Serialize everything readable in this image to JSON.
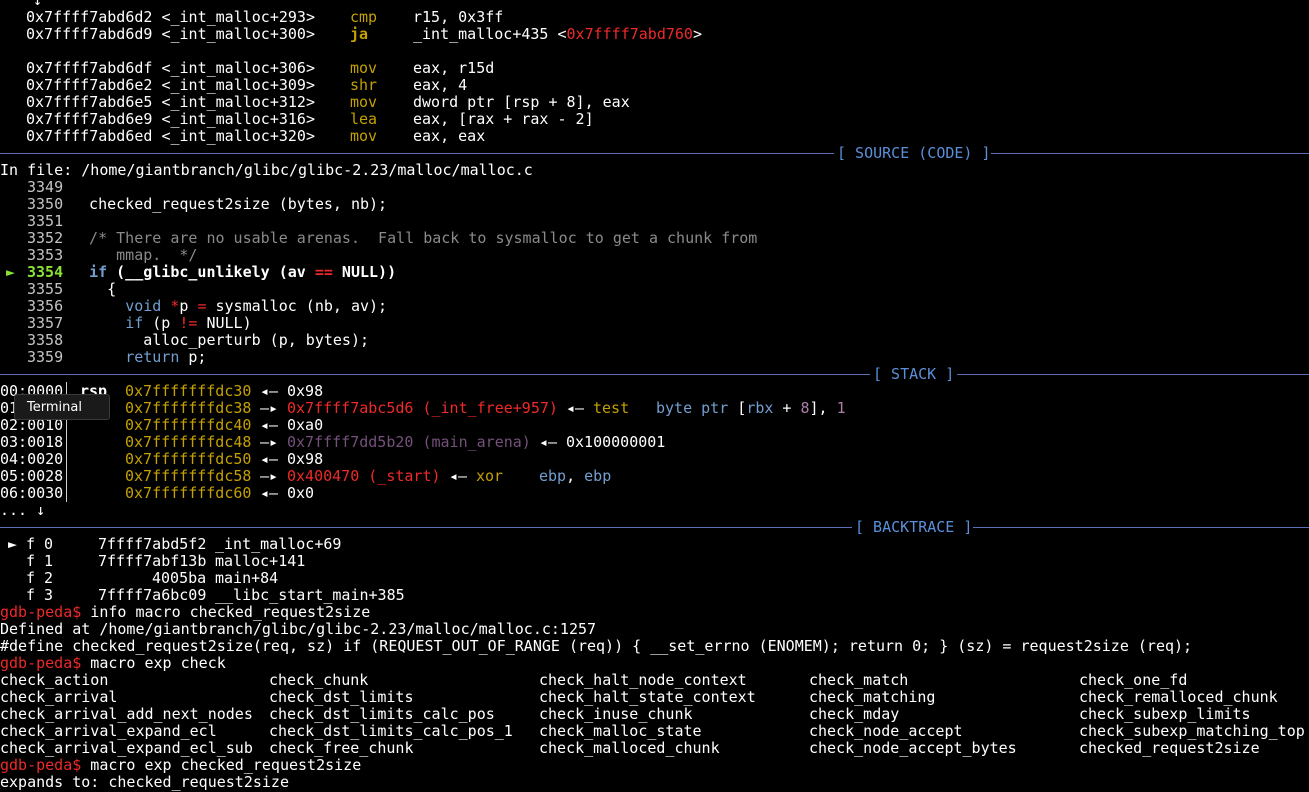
{
  "disasm": [
    {
      "addr": "0x7ffff7abd6d2",
      "sym": "<_int_malloc+293>",
      "op": "cmp",
      "args": "r15, 0x3ff"
    },
    {
      "addr": "0x7ffff7abd6d9",
      "sym": "<_int_malloc+300>",
      "op": "ja",
      "args": "_int_malloc+435 <",
      "target": "0x7ffff7abd760",
      "close": ">"
    },
    {
      "addr": "0x7ffff7abd6df",
      "sym": "<_int_malloc+306>",
      "op": "mov",
      "args": "eax, r15d"
    },
    {
      "addr": "0x7ffff7abd6e2",
      "sym": "<_int_malloc+309>",
      "op": "shr",
      "args": "eax, 4"
    },
    {
      "addr": "0x7ffff7abd6e5",
      "sym": "<_int_malloc+312>",
      "op": "mov",
      "args": "dword ptr [rsp + 8], eax"
    },
    {
      "addr": "0x7ffff7abd6e9",
      "sym": "<_int_malloc+316>",
      "op": "lea",
      "args": "eax, [rax + rax - 2]"
    },
    {
      "addr": "0x7ffff7abd6ed",
      "sym": "<_int_malloc+320>",
      "op": "mov",
      "args": "eax, eax"
    }
  ],
  "sections": {
    "source": "[ SOURCE (CODE) ]",
    "stack": "[ STACK ]",
    "backtrace": "[ BACKTRACE ]"
  },
  "source": {
    "file_line": "In file: /home/giantbranch/glibc/glibc-2.23/malloc/malloc.c",
    "lines": [
      {
        "no": "3349",
        "code": ""
      },
      {
        "no": "3350",
        "code": "  checked_request2size (bytes, nb);"
      },
      {
        "no": "3351",
        "code": ""
      },
      {
        "no": "3352",
        "code": "  /* There are no usable arenas.  Fall back to sysmalloc to get a chunk from"
      },
      {
        "no": "3353",
        "code": "     mmap.  */"
      },
      {
        "no": "3354",
        "code": "  if (__glibc_unlikely (av == NULL))",
        "current": true
      },
      {
        "no": "3355",
        "code": "    {"
      },
      {
        "no": "3356",
        "code": "      void *p = sysmalloc (nb, av);"
      },
      {
        "no": "3357",
        "code": "      if (p != NULL)"
      },
      {
        "no": "3358",
        "code": "        alloc_perturb (p, bytes);"
      },
      {
        "no": "3359",
        "code": "      return p;"
      }
    ],
    "current_marker": "►"
  },
  "stack": [
    {
      "idx": "00:0000",
      "reg": "rsp",
      "addr": "0x7fffffffdc30",
      "arrow": "◂—",
      "val": "0x98"
    },
    {
      "idx": "01:0008",
      "reg": "",
      "addr": "0x7fffffffdc38",
      "arrow": "—▸",
      "val": "0x7ffff7abc5d6 (_int_free+957)",
      "arrow2": "◂—",
      "ins": "test",
      "ins_args": "byte ptr [rbx + 8], 1"
    },
    {
      "idx": "02:0010",
      "reg": "",
      "addr": "0x7fffffffdc40",
      "arrow": "◂—",
      "val": "0xa0"
    },
    {
      "idx": "03:0018",
      "reg": "",
      "addr": "0x7fffffffdc48",
      "arrow": "—▸",
      "val": "0x7ffff7dd5b20 (main_arena)",
      "arrow2": "◂—",
      "tail": "0x100000001"
    },
    {
      "idx": "04:0020",
      "reg": "",
      "addr": "0x7fffffffdc50",
      "arrow": "◂—",
      "val": "0x98"
    },
    {
      "idx": "05:0028",
      "reg": "",
      "addr": "0x7fffffffdc58",
      "arrow": "—▸",
      "val": "0x400470 (_start)",
      "arrow2": "◂—",
      "ins": "xor",
      "ins_args": "ebp, ebp"
    },
    {
      "idx": "06:0030",
      "reg": "",
      "addr": "0x7fffffffdc60",
      "arrow": "◂—",
      "val": "0x0"
    }
  ],
  "stack_more": "... ↓",
  "top_more": "↓",
  "backtrace": [
    {
      "marker": "►",
      "frame": "f 0",
      "addr": "7ffff7abd5f2",
      "sym": "_int_malloc+69"
    },
    {
      "marker": "",
      "frame": "f 1",
      "addr": "7ffff7abf13b",
      "sym": "malloc+141"
    },
    {
      "marker": "",
      "frame": "f 2",
      "addr": "4005ba",
      "sym": "main+84"
    },
    {
      "marker": "",
      "frame": "f 3",
      "addr": "7ffff7a6bc09",
      "sym": "__libc_start_main+385"
    }
  ],
  "console": {
    "prompt": "gdb-peda$",
    "cmd1": " info macro checked_request2size",
    "out1": "Defined at /home/giantbranch/glibc/glibc-2.23/malloc/malloc.c:1257",
    "out2": "#define checked_request2size(req, sz) if (REQUEST_OUT_OF_RANGE (req)) { __set_errno (ENOMEM); return 0; } (sz) = request2size (req);",
    "cmd2": " macro exp check",
    "completions": [
      [
        "check_action",
        "check_chunk",
        "check_halt_node_context",
        "check_match",
        "check_one_fd"
      ],
      [
        "check_arrival",
        "check_dst_limits",
        "check_halt_state_context",
        "check_matching",
        "check_remalloced_chunk"
      ],
      [
        "check_arrival_add_next_nodes",
        "check_dst_limits_calc_pos",
        "check_inuse_chunk",
        "check_mday",
        "check_subexp_limits"
      ],
      [
        "check_arrival_expand_ecl",
        "check_dst_limits_calc_pos_1",
        "check_malloc_state",
        "check_node_accept",
        "check_subexp_matching_top"
      ],
      [
        "check_arrival_expand_ecl_sub",
        "check_free_chunk",
        "check_malloced_chunk",
        "check_node_accept_bytes",
        "checked_request2size"
      ]
    ],
    "cmd3": " macro exp checked_request2size",
    "out3": "expands to: checked_request2size"
  },
  "tooltip": "Terminal"
}
